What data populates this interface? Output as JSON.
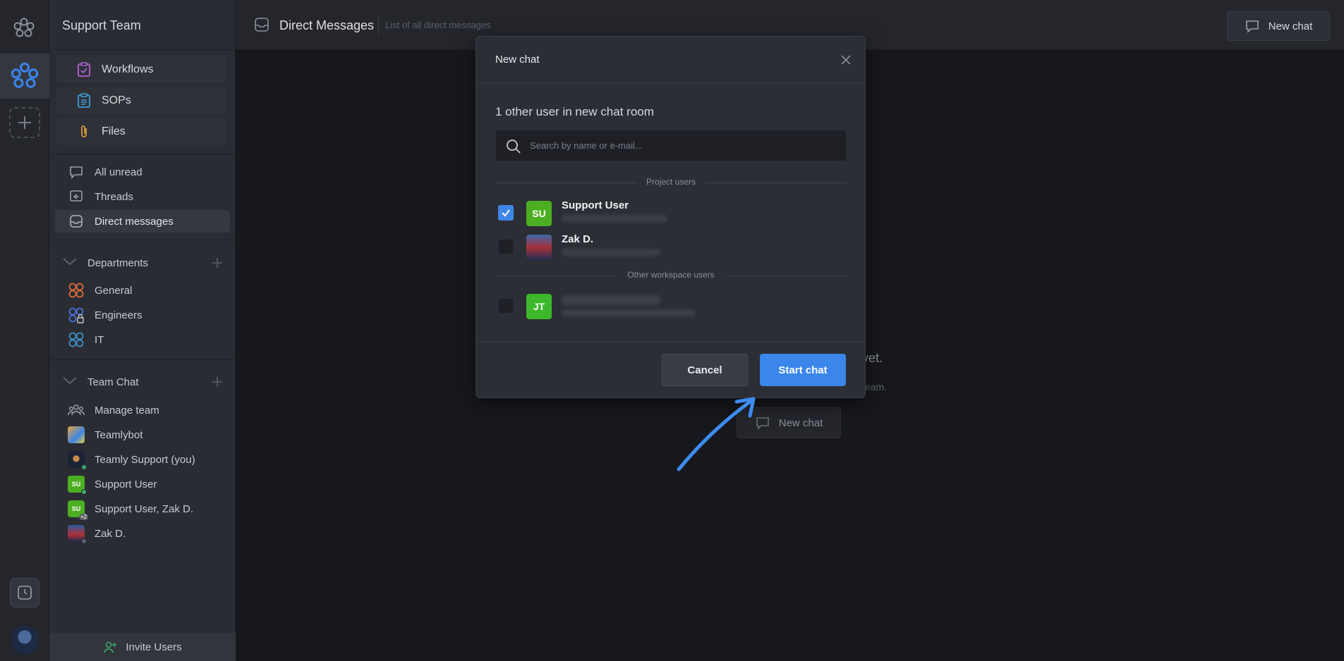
{
  "sidebar": {
    "title": "Support Team",
    "tools": [
      {
        "label": "Workflows",
        "icon": "clipboard-check-icon",
        "color": "#b062d8"
      },
      {
        "label": "SOPs",
        "icon": "list-doc-icon",
        "color": "#3f9ed8"
      },
      {
        "label": "Files",
        "icon": "paperclip-icon",
        "color": "#d89a3a"
      }
    ],
    "nav": [
      {
        "label": "All unread",
        "icon": "chat-bubble-icon"
      },
      {
        "label": "Threads",
        "icon": "threads-icon"
      },
      {
        "label": "Direct messages",
        "icon": "inbox-icon",
        "active": true
      }
    ],
    "departments": {
      "label": "Departments",
      "items": [
        {
          "label": "General",
          "icon": "four-circles-icon",
          "color": "#d86a3a"
        },
        {
          "label": "Engineers",
          "icon": "four-circles-lock-icon",
          "color": "#4a6fd8"
        },
        {
          "label": "IT",
          "icon": "four-circles-icon",
          "color": "#3f8ec8"
        }
      ]
    },
    "team_chat": {
      "label": "Team Chat",
      "items": [
        {
          "label": "Manage team",
          "avatar": "team-icon"
        },
        {
          "label": "Teamlybot",
          "avatar": "bot-avatar"
        },
        {
          "label": "Teamly Support (you)",
          "avatar": "photo-avatar"
        },
        {
          "label": "Support User",
          "avatar": "SU"
        },
        {
          "label": "Support User, Zak D.",
          "avatar": "SU",
          "extra": "+2"
        },
        {
          "label": "Zak D.",
          "avatar": "photo-avatar"
        }
      ]
    },
    "invite": "Invite Users"
  },
  "topbar": {
    "title": "Direct Messages",
    "subtitle": "List of all direct messages",
    "new_chat": "New chat"
  },
  "background": {
    "empty_title": "yet.",
    "empty_sub": "team.",
    "new_chat": "New chat"
  },
  "modal": {
    "title": "New chat",
    "count_text": "1 other user in new chat room",
    "search_placeholder": "Search by name or e-mail...",
    "project_users_label": "Project users",
    "other_users_label": "Other workspace users",
    "users": [
      {
        "initials": "SU",
        "name": "Support User",
        "checked": true,
        "color": "#4caf22"
      },
      {
        "initials": "",
        "name": "Zak D.",
        "checked": false,
        "color": "#2d4a7a"
      },
      {
        "initials": "JT",
        "name": "",
        "checked": false,
        "color": "#3cb82a"
      }
    ],
    "cancel": "Cancel",
    "start": "Start chat"
  },
  "colors": {
    "accent": "#3a86ea",
    "annotation_arrow": "#3d8cf0"
  }
}
